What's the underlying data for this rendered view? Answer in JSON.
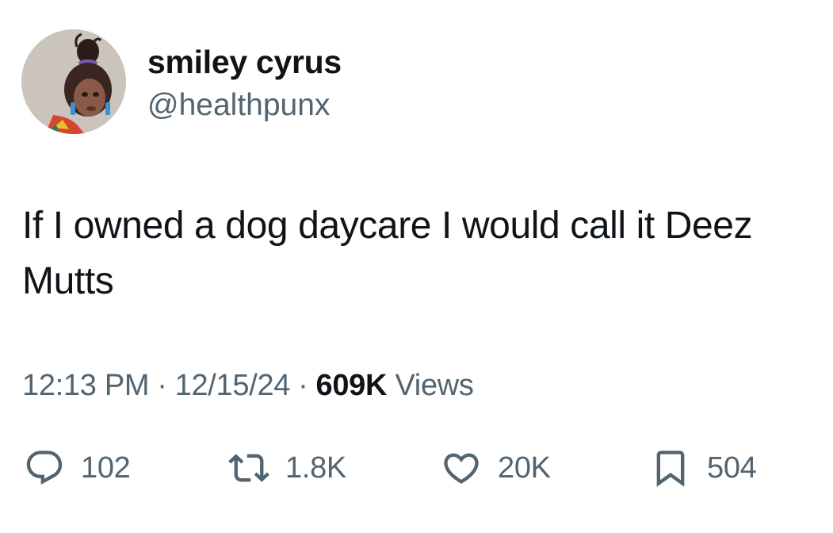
{
  "user": {
    "display_name": "smiley cyrus",
    "handle": "@healthpunx"
  },
  "tweet": {
    "text": "If I owned a dog daycare I would call it Deez Mutts"
  },
  "meta": {
    "time": "12:13 PM",
    "separator": "·",
    "date": "12/15/24",
    "views_count": "609K",
    "views_label": "Views"
  },
  "actions": {
    "replies": "102",
    "reposts": "1.8K",
    "likes": "20K",
    "bookmarks": "504"
  },
  "colors": {
    "text": "#0f1419",
    "secondary": "#536471",
    "background": "#ffffff"
  },
  "icons": [
    "reply-icon",
    "repost-icon",
    "like-icon",
    "bookmark-icon"
  ]
}
